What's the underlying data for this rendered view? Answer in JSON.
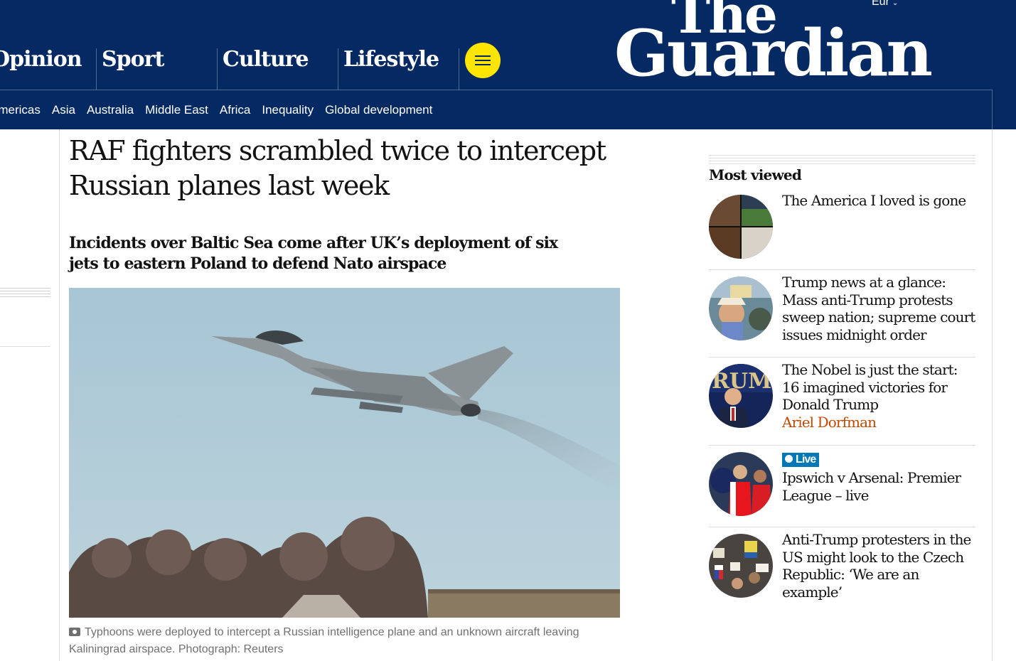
{
  "header": {
    "edition": "Eur",
    "logo_line1": "The",
    "logo_line2": "Guardian",
    "pillars": [
      "Opinion",
      "Sport",
      "Culture",
      "Lifestyle"
    ],
    "subnav": [
      "Americas",
      "Asia",
      "Australia",
      "Middle East",
      "Africa",
      "Inequality",
      "Global development"
    ],
    "accent_color": "#052962",
    "menu_button_color": "#ffe500"
  },
  "article": {
    "headline": "RAF fighters scrambled twice to intercept Russian planes last week",
    "standfirst": "Incidents over Baltic Sea come after UK’s deployment of six jets to eastern Poland to defend Nato airspace",
    "image_icon": "typhoon-jet-photo",
    "caption": "Typhoons were deployed to intercept a Russian intelligence plane and an unknown aircraft leaving Kaliningrad airspace. Photograph: Reuters"
  },
  "most_viewed": {
    "title": "Most viewed",
    "items": [
      {
        "headline": "The America I loved is gone",
        "byline": ""
      },
      {
        "headline": "Trump news at a glance: Mass anti-Trump protests sweep nation; supreme court issues midnight order",
        "byline": ""
      },
      {
        "headline": "The Nobel is just the start: 16 imagined victories for Donald Trump",
        "byline": "Ariel Dorfman"
      },
      {
        "headline": "Ipswich v Arsenal: Premier League – live",
        "byline": "",
        "live_label": "Live"
      },
      {
        "headline": "Anti-Trump protesters in the US might look to the Czech Republic: ‘We are an example’",
        "byline": ""
      }
    ],
    "byline_color": "#c74600",
    "live_color": "#0077b6"
  }
}
